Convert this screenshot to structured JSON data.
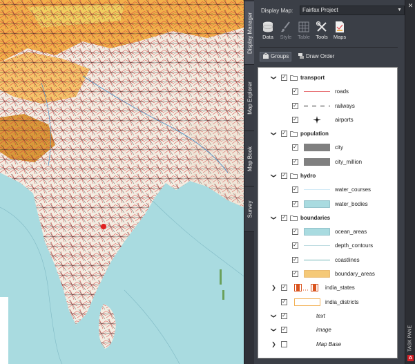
{
  "side_tabs": [
    "Display Manager",
    "Map Explorer",
    "Map Book",
    "Survey"
  ],
  "panel": {
    "display_map_label": "Display Map:",
    "display_map_value": "Fairfax Project",
    "toolbar": {
      "data": "Data",
      "style": "Style",
      "table": "Table",
      "tools": "Tools",
      "maps": "Maps"
    },
    "subbar": {
      "groups": "Groups",
      "draw_order": "Draw Order"
    },
    "strip_label": "TASK PANE"
  },
  "layers": {
    "transport": "transport",
    "roads": "roads",
    "railways": "railways",
    "airports": "airports",
    "population": "population",
    "city": "city",
    "city_million": "city_million",
    "hydro": "hydro",
    "water_courses": "water_courses",
    "water_bodies": "water_bodies",
    "boundaries": "boundaries",
    "ocean_areas": "ocean_areas",
    "depth_contours": "depth_contours",
    "coastlines": "coastlines",
    "boundary_areas": "boundary_areas",
    "india_states": "india_states",
    "india_districts": "india_districts",
    "text": "text",
    "image": "image",
    "map_base": "Map Base"
  },
  "colors": {
    "ocean": "#a9dbe0",
    "land": "#f4ede2",
    "desert": "#f2b04a",
    "panel_bg": "#3b3f47",
    "road": "#e0474c",
    "water_body": "#a9dbe0",
    "boundary_area": "#f5c978",
    "city_symbol": "#808080"
  }
}
